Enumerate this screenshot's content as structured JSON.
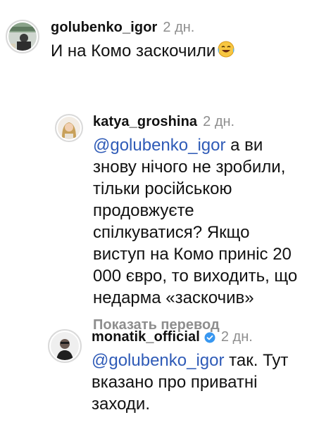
{
  "comments": [
    {
      "username": "golubenko_igor",
      "time": "2 дн.",
      "text": "И на Комо заскочили",
      "emoji": "laughing-tears-emoji"
    },
    {
      "username": "katya_groshina",
      "time": "2 дн.",
      "mention": "@golubenko_igor",
      "text": " а ви знову нічого не зробили, тільки російською продовжуєте спілкуватися? Якщо виступ на Комо приніс 20 000 євро, то виходить, що недарма «заскочив»",
      "translate_label": "Показать перевод"
    },
    {
      "username": "monatik_official",
      "verified": true,
      "time": "2 дн.",
      "mention": "@golubenko_igor",
      "text": " так. Тут вказано  про приватні заходи."
    }
  ],
  "colors": {
    "mention": "#2f5bb7",
    "muted": "#8e8e8e",
    "verified": "#3897f0"
  }
}
